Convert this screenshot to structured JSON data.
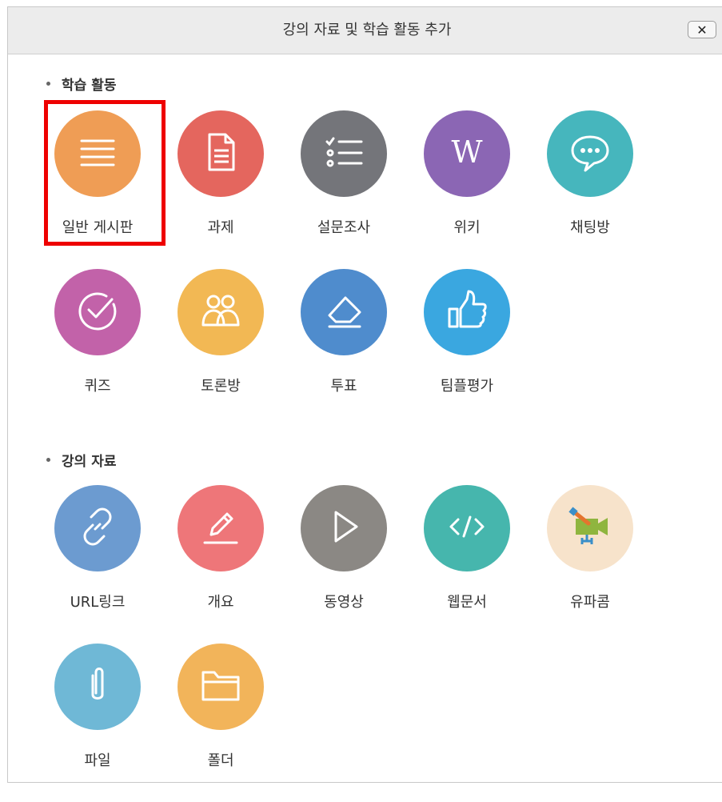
{
  "dialog": {
    "title": "강의 자료 및 학습 활동 추가",
    "close_label": "✕"
  },
  "sections": {
    "activities": {
      "title": "학습 활동",
      "items": [
        {
          "label": "일반 게시판",
          "icon": "board-lines-icon",
          "color": "#ef9d55"
        },
        {
          "label": "과제",
          "icon": "document-icon",
          "color": "#e4665e"
        },
        {
          "label": "설문조사",
          "icon": "checklist-icon",
          "color": "#74757a"
        },
        {
          "label": "위키",
          "icon": "wiki-icon",
          "color": "#8b66b4"
        },
        {
          "label": "채팅방",
          "icon": "chat-bubble-icon",
          "color": "#46b6bd"
        },
        {
          "label": "퀴즈",
          "icon": "checkmark-circle-icon",
          "color": "#c262a9"
        },
        {
          "label": "토론방",
          "icon": "people-icon",
          "color": "#f2b854"
        },
        {
          "label": "투표",
          "icon": "eraser-icon",
          "color": "#4f8ccd"
        },
        {
          "label": "팀플평가",
          "icon": "thumbs-up-icon",
          "color": "#3aa7e0"
        }
      ]
    },
    "resources": {
      "title": "강의 자료",
      "items": [
        {
          "label": "URL링크",
          "icon": "link-icon",
          "color": "#6c9bd0"
        },
        {
          "label": "개요",
          "icon": "pencil-icon",
          "color": "#ee7679"
        },
        {
          "label": "동영상",
          "icon": "play-icon",
          "color": "#8b8884"
        },
        {
          "label": "웹문서",
          "icon": "code-icon",
          "color": "#46b6ad"
        },
        {
          "label": "유파콤",
          "icon": "video-camera-icon",
          "color": "#f7e3cb"
        },
        {
          "label": "파일",
          "icon": "paperclip-icon",
          "color": "#6fb8d6"
        },
        {
          "label": "폴더",
          "icon": "folder-icon",
          "color": "#f2b45a"
        }
      ]
    }
  }
}
